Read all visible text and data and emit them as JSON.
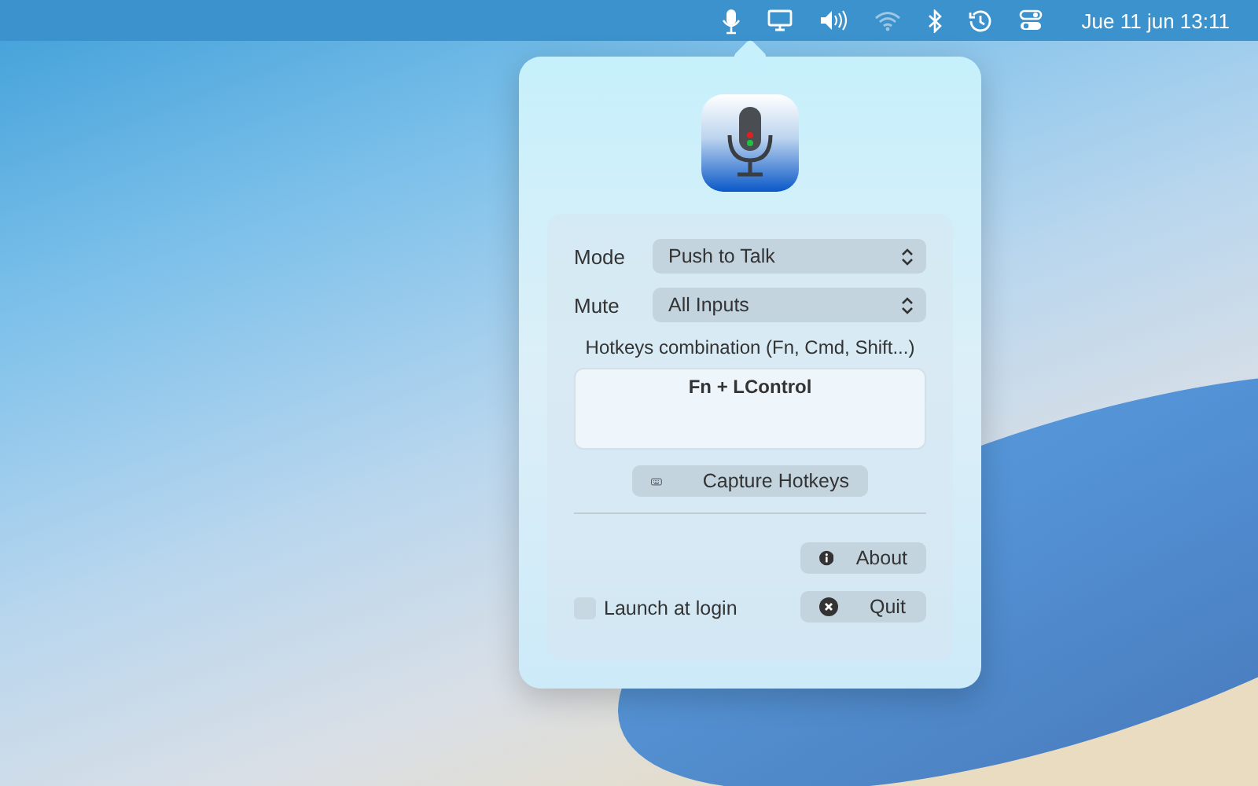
{
  "menu_bar": {
    "clock": "Jue 11 jun 13:11"
  },
  "popover": {
    "settings": [
      {
        "label": "Mode",
        "value": "Push to Talk"
      },
      {
        "label": "Mute",
        "value": "All Inputs"
      }
    ],
    "hotkeys_label": "Hotkeys combination (Fn, Cmd, Shift...)",
    "hotkeys_value": "Fn + LControl",
    "capture_button": "Capture Hotkeys",
    "about_button": "About",
    "quit_button": "Quit",
    "launch_at_login": {
      "label": "Launch at login",
      "checked": false
    }
  }
}
